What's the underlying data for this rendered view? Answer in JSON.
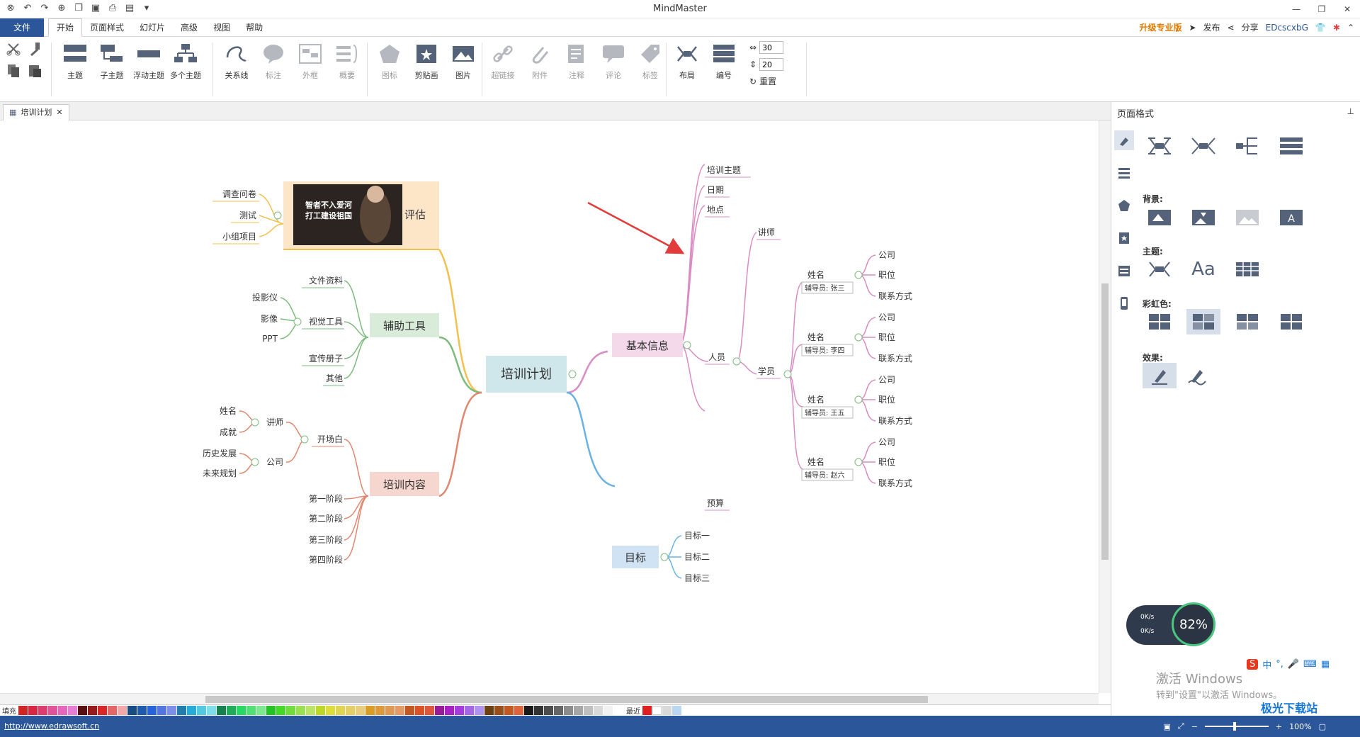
{
  "app": {
    "title": "MindMaster"
  },
  "menu": {
    "file": "文件",
    "tabs": [
      "开始",
      "页面样式",
      "幻灯片",
      "高级",
      "视图",
      "帮助"
    ],
    "upgrade": "升级专业版",
    "publish": "发布",
    "share": "分享",
    "user": "EDcscxbG"
  },
  "ribbon": {
    "topic": "主题",
    "subtopic": "子主题",
    "floating": "浮动主题",
    "multi": "多个主题",
    "relation": "关系线",
    "callout": "标注",
    "boundary": "外框",
    "summary": "概要",
    "icon": "图标",
    "clipart": "剪贴画",
    "picture": "图片",
    "hyperlink": "超链接",
    "attachment": "附件",
    "note": "注释",
    "comment": "评论",
    "tag": "标签",
    "layout": "布局",
    "numbering": "编号",
    "spacing_h": "30",
    "spacing_v": "20",
    "reset": "重置"
  },
  "doc_tab": "培训计划",
  "side_panel": {
    "title": "页面格式",
    "background": "背景:",
    "theme": "主题:",
    "rainbow": "彩虹色:",
    "effect": "效果:"
  },
  "mindmap": {
    "central": "培训计划",
    "right": {
      "basic": {
        "label": "基本信息",
        "items": [
          "培训主题",
          "日期",
          "地点",
          "预算"
        ],
        "people": {
          "label": "人员",
          "lecturer": "讲师",
          "students": {
            "label": "学员",
            "entries": [
              {
                "name": "姓名",
                "tag": "辅导员: 张三",
                "fields": [
                  "公司",
                  "职位",
                  "联系方式"
                ]
              },
              {
                "name": "姓名",
                "tag": "辅导员: 李四",
                "fields": [
                  "公司",
                  "职位",
                  "联系方式"
                ]
              },
              {
                "name": "姓名",
                "tag": "辅导员: 王五",
                "fields": [
                  "公司",
                  "职位",
                  "联系方式"
                ]
              },
              {
                "name": "姓名",
                "tag": "辅导员: 赵六",
                "fields": [
                  "公司",
                  "职位",
                  "联系方式"
                ]
              }
            ]
          }
        }
      },
      "goal": {
        "label": "目标",
        "items": [
          "目标一",
          "目标二",
          "目标三"
        ]
      }
    },
    "left": {
      "eval": {
        "label": "评估",
        "image_text": [
          "智者不入爱河",
          "打工建设祖国"
        ],
        "items": [
          "调查问卷",
          "测试",
          "小组项目"
        ]
      },
      "tools": {
        "label": "辅助工具",
        "docs": "文件资料",
        "visual": {
          "label": "视觉工具",
          "items": [
            "投影仪",
            "影像",
            "PPT"
          ]
        },
        "brochure": "宣传册子",
        "other": "其他"
      },
      "content": {
        "label": "培训内容",
        "opening": {
          "label": "开场白",
          "lecturer": {
            "label": "讲师",
            "items": [
              "姓名",
              "成就"
            ]
          },
          "company": {
            "label": "公司",
            "items": [
              "历史发展",
              "未来规划"
            ]
          }
        },
        "stages": [
          "第一阶段",
          "第二阶段",
          "第三阶段",
          "第四阶段"
        ]
      }
    }
  },
  "palette": {
    "fill_label": "填充",
    "recent_label": "最近"
  },
  "status": {
    "link": "http://www.edrawsoft.cn",
    "zoom": "100%"
  },
  "overlay": {
    "net_up": "0K/s",
    "net_down": "0K/s",
    "gauge": "82%",
    "activate_title": "激活 Windows",
    "activate_sub": "转到\"设置\"以激活 Windows。",
    "ime_lang": "中",
    "site_logo": "极光下载站"
  },
  "colors": {
    "accent": "#2b579a",
    "central_fill": "#cfe7ea",
    "basic_fill": "#f3d9ea",
    "goal_fill": "#cfe3f5",
    "tools_fill": "#d9ecd9",
    "content_fill": "#f6d7cf",
    "eval_fill": "#fde6c8",
    "pink": "#d98cc4",
    "blue": "#6ab2e3",
    "green": "#7dbb7d",
    "orange": "#e0876f",
    "yellow": "#f2c04d"
  }
}
